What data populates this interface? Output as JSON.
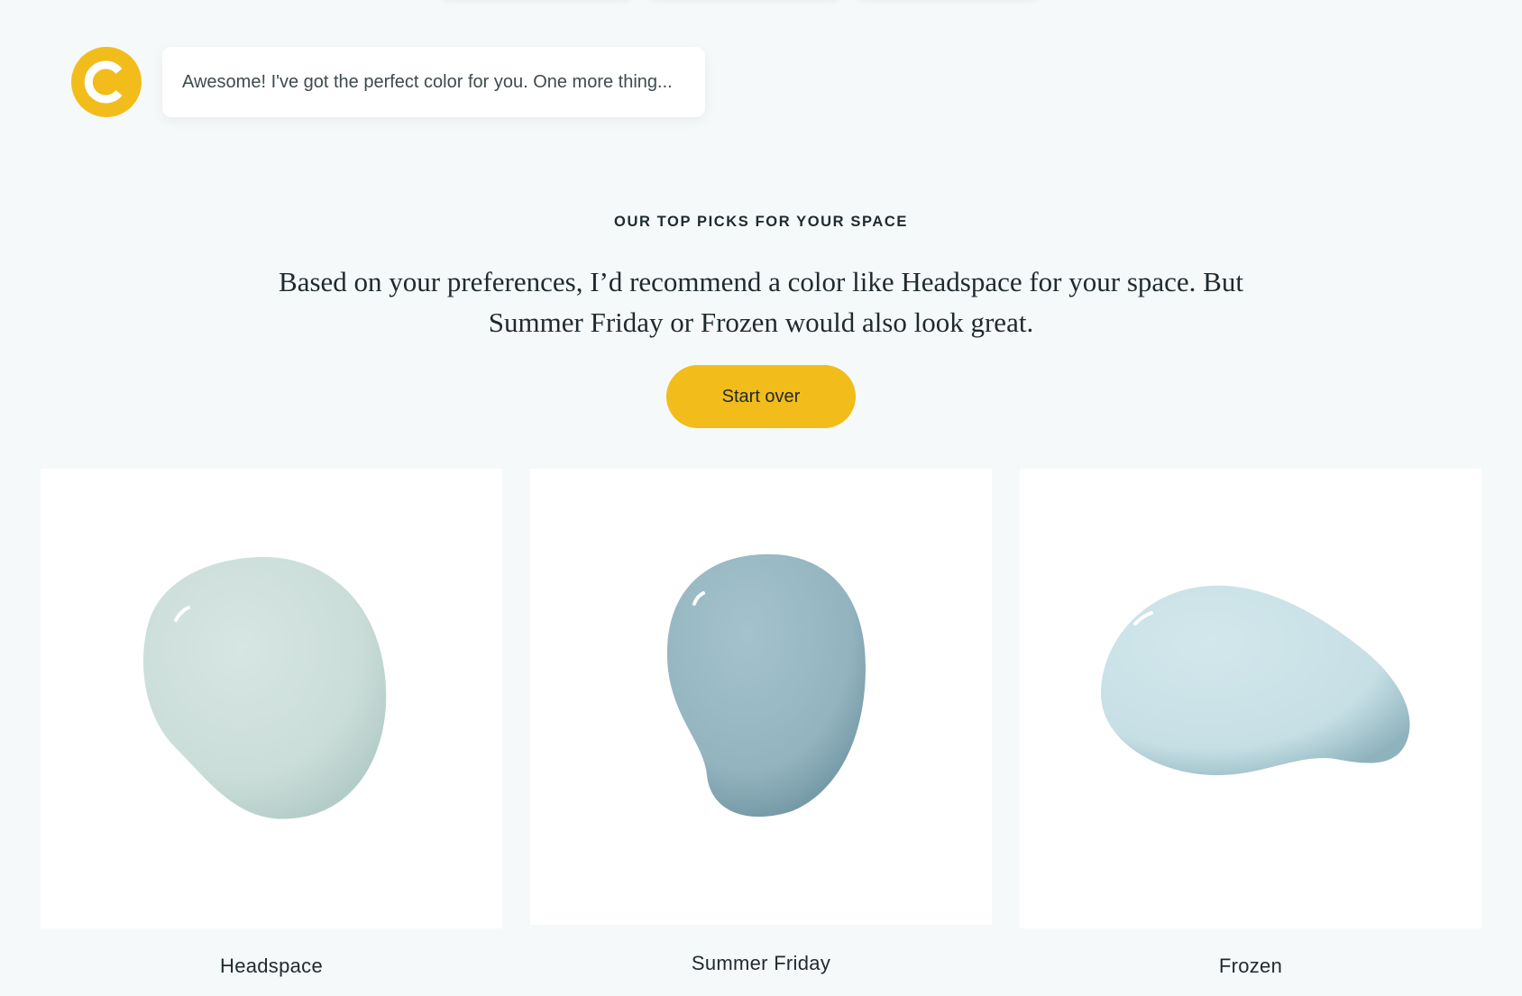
{
  "chat": {
    "avatar_letter": "C",
    "message": "Awesome! I've got the perfect color for you. One more thing..."
  },
  "picks": {
    "eyebrow": "OUR TOP PICKS FOR YOUR SPACE",
    "recommendation": "Based on your preferences, I’d recommend a color like Headspace for your space. But Summer Friday or Frozen would also look great.",
    "start_over_label": "Start over"
  },
  "colors": {
    "accent": "#f2bc1b",
    "background": "#f6f9fa"
  },
  "swatches": [
    {
      "name": "Headspace",
      "color": "#cfe0dd"
    },
    {
      "name": "Summer Friday",
      "color": "#93b4bf"
    },
    {
      "name": "Frozen",
      "color": "#c8e0e6"
    }
  ]
}
